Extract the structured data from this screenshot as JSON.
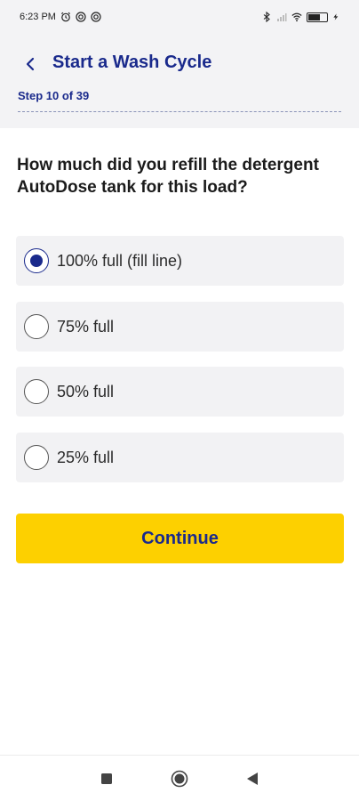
{
  "status_bar": {
    "time": "6:23 PM"
  },
  "header": {
    "title": "Start a Wash Cycle",
    "step": "Step 10 of 39"
  },
  "question": "How much did you refill the detergent AutoDose tank for this load?",
  "options": [
    {
      "label": "100% full (fill line)",
      "selected": true
    },
    {
      "label": "75% full",
      "selected": false
    },
    {
      "label": "50% full",
      "selected": false
    },
    {
      "label": "25% full",
      "selected": false
    }
  ],
  "continue_label": "Continue",
  "colors": {
    "brand_blue": "#1a2a8c",
    "accent_yellow": "#fdd000",
    "header_bg": "#f3f3f5",
    "option_bg": "#f2f2f4"
  }
}
